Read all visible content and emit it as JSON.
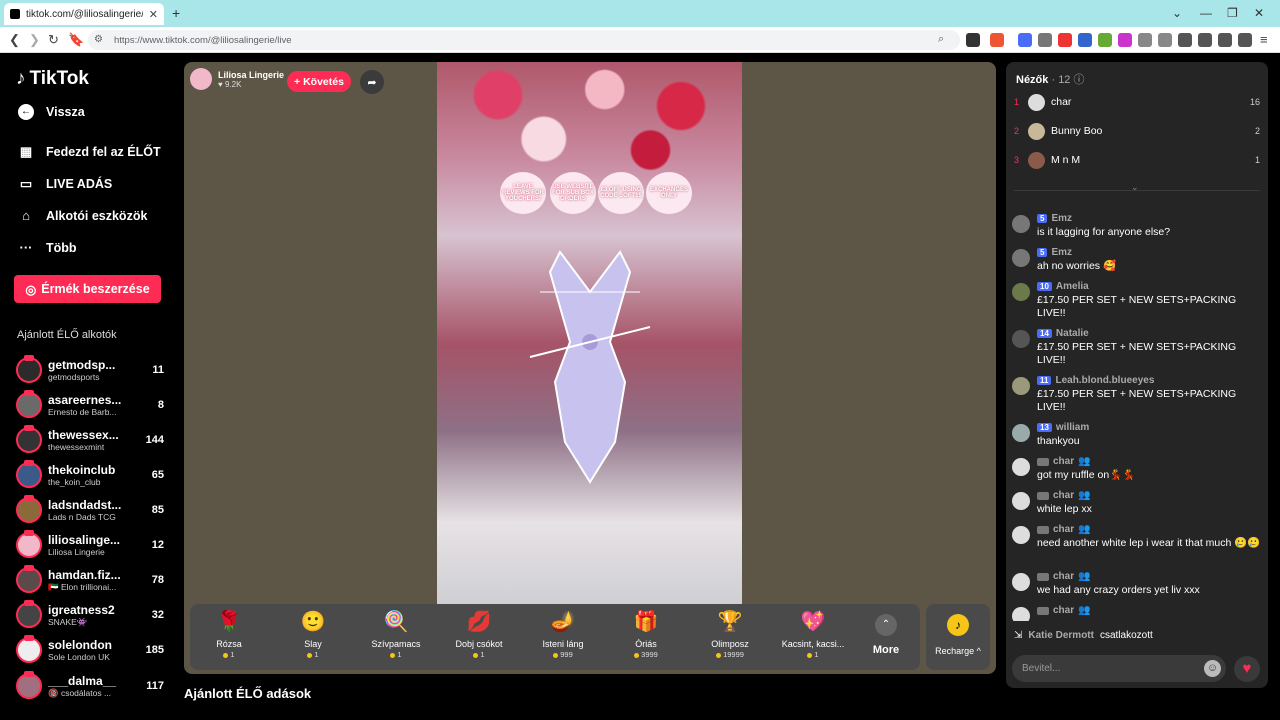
{
  "browser": {
    "tab_title": "tiktok.com/@liliosalingerie/li",
    "url": "https://www.tiktok.com/@liliosalingerie/live"
  },
  "sidebar": {
    "logo": "TikTok",
    "back": "Vissza",
    "nav": [
      "Fedezd fel az ÉLŐT",
      "LIVE ADÁS",
      "Alkotói eszközök",
      "Több"
    ],
    "coins_button": "Érmék beszerzése",
    "recommended_heading": "Ajánlott ÉLŐ alkotók",
    "creators": [
      {
        "name": "getmodsp...",
        "sub": "getmodsports",
        "count": "11",
        "color": "#2b2b2b"
      },
      {
        "name": "asareernes...",
        "sub": "Ernesto de Barb...",
        "count": "8",
        "color": "#6a6a6a"
      },
      {
        "name": "thewessex...",
        "sub": "thewessexmint",
        "count": "144",
        "color": "#333"
      },
      {
        "name": "thekoinclub",
        "sub": "the_koin_club",
        "count": "65",
        "color": "#3b5a8a"
      },
      {
        "name": "ladsndadst...",
        "sub": "Lads n Dads TCG",
        "count": "85",
        "color": "#8a6a3a"
      },
      {
        "name": "liliosalinge...",
        "sub": "Liliosa Lingerie",
        "count": "12",
        "color": "#f0b8c8"
      },
      {
        "name": "hamdan.fiz...",
        "sub": "🇦🇪 Elon trillionai...",
        "count": "78",
        "color": "#5a4a4a"
      },
      {
        "name": "igreatness2",
        "sub": "SNAKE👾",
        "count": "32",
        "color": "#444"
      },
      {
        "name": "solelondon",
        "sub": "Sole London UK",
        "count": "185",
        "color": "#eee"
      },
      {
        "name": "___dalma__",
        "sub": "🔞 csodálatos ...",
        "count": "117",
        "color": "#a07080"
      }
    ]
  },
  "stream": {
    "host_name": "Liliosa Lingerie",
    "host_likes": "♥ 9.2K",
    "follow": "+ Követés",
    "signs": [
      "LEAVE REVIEWS FOR YOUCHERS!",
      "USE WEBSITE FOR SUB BOX ORDERS",
      "£3 OFF USING CODE SOFT15",
      "EXCHANGES ONLY"
    ],
    "gifts": [
      {
        "icon": "🌹",
        "name": "Rózsa",
        "price": "1"
      },
      {
        "icon": "🙂",
        "name": "Slay",
        "price": "1"
      },
      {
        "icon": "🍭",
        "name": "Szívpamacs",
        "price": "1"
      },
      {
        "icon": "💋",
        "name": "Dobj csókot",
        "price": "1"
      },
      {
        "icon": "🪔",
        "name": "Isteni láng",
        "price": "999"
      },
      {
        "icon": "🎁",
        "name": "Óriás",
        "price": "3999"
      },
      {
        "icon": "🏆",
        "name": "Olimposz",
        "price": "19999"
      },
      {
        "icon": "💖",
        "name": "Kacsint, kacsi...",
        "price": "1"
      }
    ],
    "more": "More",
    "recharge": "Recharge ^",
    "recommended_below": "Ajánlott ÉLŐ adások"
  },
  "chat": {
    "viewers_label": "Nézők",
    "viewers_count": "· 12",
    "top_viewers": [
      {
        "rank": "1",
        "name": "char",
        "count": "16",
        "color": "#ddd"
      },
      {
        "rank": "2",
        "name": "Bunny Boo",
        "count": "2",
        "color": "#c8b89a"
      },
      {
        "rank": "3",
        "name": "M n M",
        "count": "1",
        "color": "#8a5a4a"
      }
    ],
    "messages": [
      {
        "level": "5",
        "user": "Emz",
        "text": "is it lagging for anyone else?",
        "color": "#777"
      },
      {
        "level": "5",
        "user": "Emz",
        "text": "ah no worries 🥰",
        "color": "#777"
      },
      {
        "level": "10",
        "user": "Amelia",
        "text": "£17.50 PER SET + NEW SETS+PACKING LIVE!!",
        "color": "#6a7a4a"
      },
      {
        "level": "14",
        "user": "Natalie",
        "text": "£17.50 PER SET + NEW SETS+PACKING LIVE!!",
        "color": "#555"
      },
      {
        "level": "11",
        "user": "Leah.blond.blueeyes",
        "text": "£17.50 PER SET + NEW SETS+PACKING LIVE!!",
        "color": "#9a9a7a"
      },
      {
        "level": "13",
        "user": "william",
        "text": "thankyou",
        "color": "#9aa"
      },
      {
        "level": "",
        "user": "char",
        "text": "got my ruffle on💃💃",
        "color": "#ddd"
      },
      {
        "level": "",
        "user": "char",
        "text": "white lep xx",
        "color": "#ddd"
      },
      {
        "level": "",
        "user": "char",
        "text": "need another white lep i wear it that much 🥲🥲",
        "color": "#ddd"
      },
      {
        "level": "",
        "user": "char",
        "text": "we had any crazy orders yet liv xxx",
        "color": "#ddd"
      },
      {
        "level": "",
        "user": "char",
        "text": "",
        "color": "#ddd"
      }
    ],
    "joined_user": "Katie Dermott",
    "joined_text": "csatlakozott",
    "input_placeholder": "Bevitel..."
  }
}
